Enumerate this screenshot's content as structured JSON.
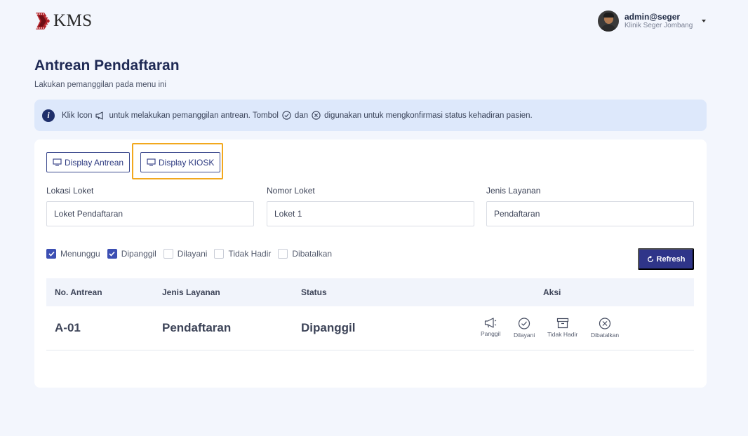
{
  "brand": {
    "name": "KMS"
  },
  "user": {
    "name": "admin@seger",
    "org": "Klinik Seger Jombang"
  },
  "page": {
    "title": "Antrean Pendaftaran",
    "subtitle": "Lakukan pemanggilan pada menu ini"
  },
  "alert": {
    "part1": "Klik Icon",
    "part2": "untuk melakukan pemanggilan antrean. Tombol",
    "part3": "dan",
    "part4": "digunakan untuk mengkonfirmasi status kehadiran pasien."
  },
  "buttons": {
    "display_antrean": "Display Antrean",
    "display_kiosk": "Display KIOSK",
    "refresh": "Refresh"
  },
  "fields": {
    "lokasi": {
      "label": "Lokasi Loket",
      "value": "Loket Pendaftaran"
    },
    "nomor": {
      "label": "Nomor Loket",
      "value": "Loket 1"
    },
    "jenis": {
      "label": "Jenis Layanan",
      "value": "Pendaftaran"
    }
  },
  "filters": [
    {
      "label": "Menunggu",
      "checked": true
    },
    {
      "label": "Dipanggil",
      "checked": true
    },
    {
      "label": "Dilayani",
      "checked": false
    },
    {
      "label": "Tidak Hadir",
      "checked": false
    },
    {
      "label": "Dibatalkan",
      "checked": false
    }
  ],
  "table": {
    "headers": [
      "No. Antrean",
      "Jenis Layanan",
      "Status",
      "Aksi"
    ],
    "rows": [
      {
        "no": "A-01",
        "layanan": "Pendaftaran",
        "status": "Dipanggil",
        "actions": [
          "Panggil",
          "Dilayani",
          "Tidak Hadir",
          "Dibatalkan"
        ]
      }
    ]
  },
  "colors": {
    "primary": "#2f3589",
    "highlight": "#f2a81d",
    "alert_bg": "#dde8fb",
    "page_bg": "#f3f6fd"
  }
}
